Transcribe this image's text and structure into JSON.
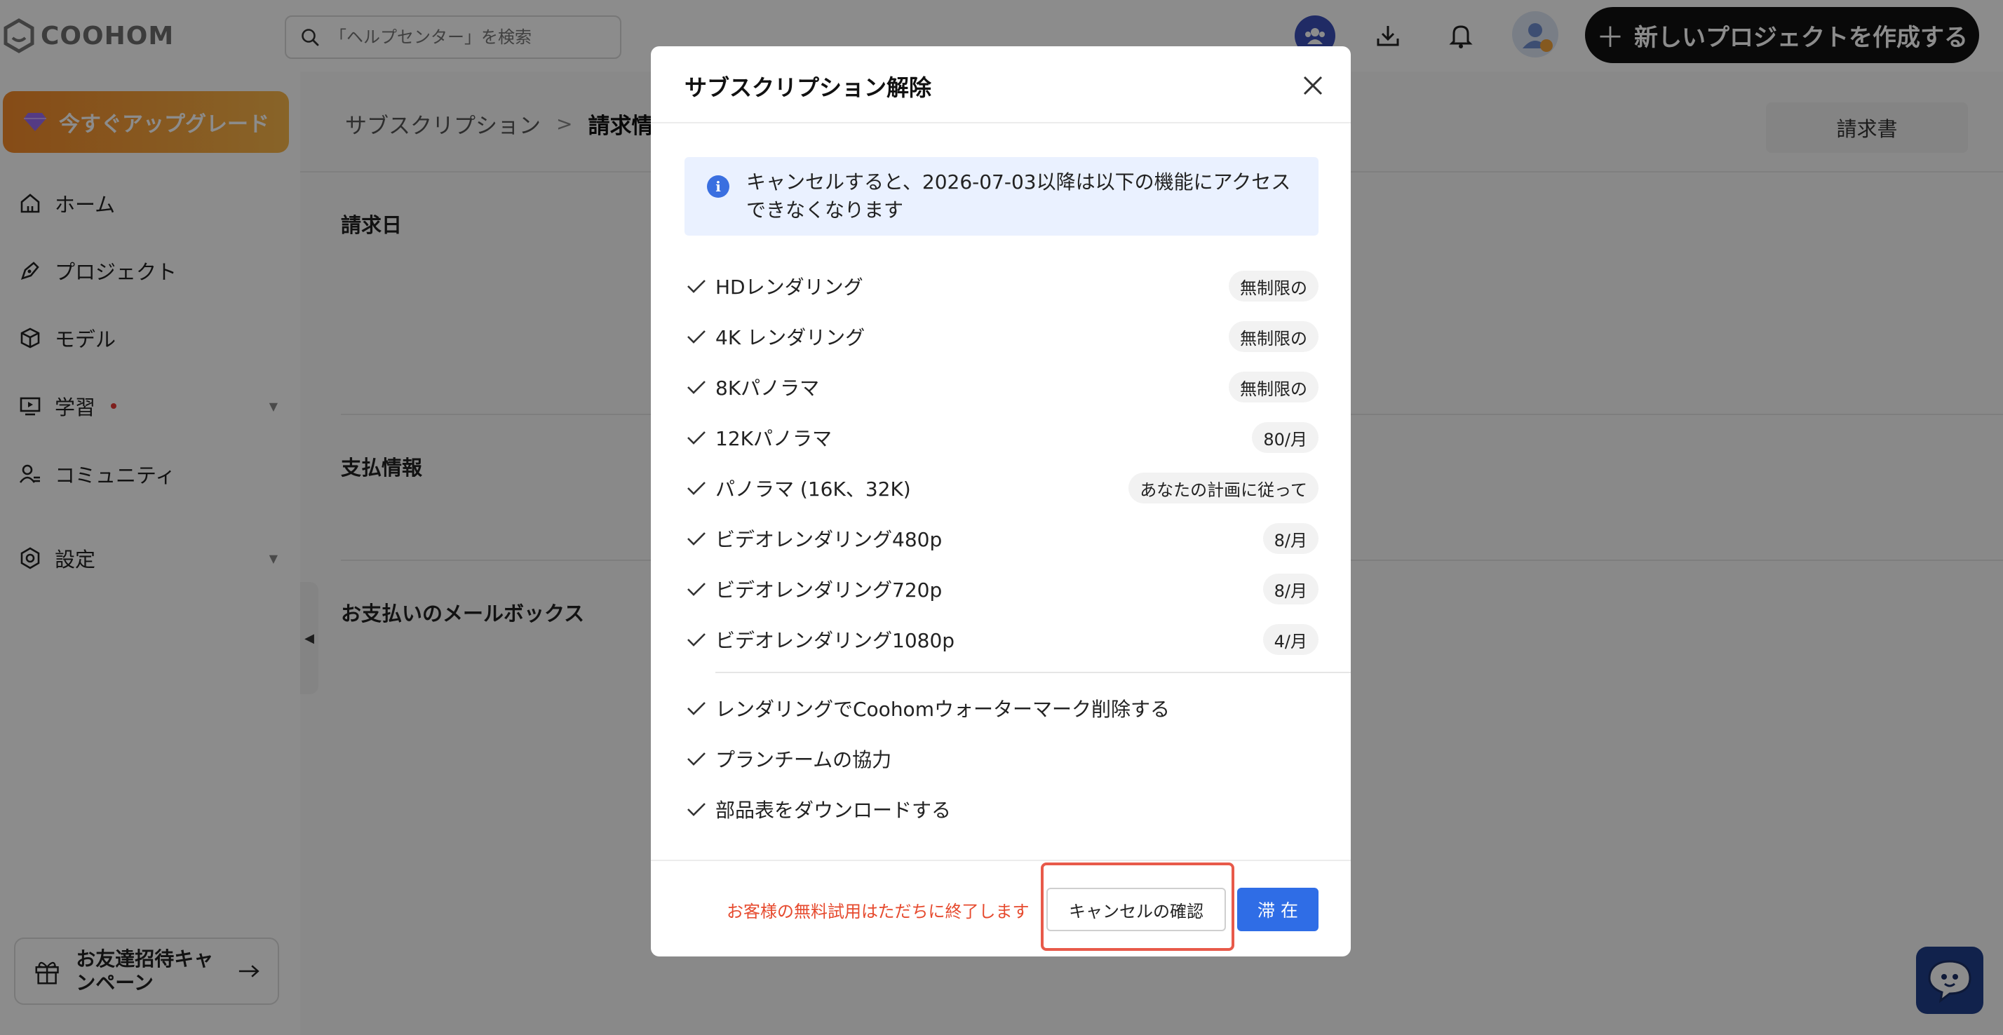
{
  "brand": {
    "name": "COOHOM"
  },
  "search": {
    "placeholder": "「ヘルプセンター」を検索"
  },
  "header": {
    "create_label": "新しいプロジェクトを作成する"
  },
  "sidebar": {
    "upgrade_label": "今すぐアップグレード",
    "items": [
      {
        "label": "ホーム",
        "icon": "home-icon"
      },
      {
        "label": "プロジェクト",
        "icon": "project-icon"
      },
      {
        "label": "モデル",
        "icon": "cube-icon"
      },
      {
        "label": "学習",
        "icon": "learning-icon"
      },
      {
        "label": "コミュニティ",
        "icon": "community-icon"
      },
      {
        "label": "設定",
        "icon": "settings-icon"
      }
    ],
    "invite_label": "お友達招待キャンペーン"
  },
  "main": {
    "breadcrumb": {
      "parent": "サブスクリプション",
      "current": "請求情報"
    },
    "invoice_label": "請求書",
    "sections": [
      "請求日",
      "支払情報",
      "お支払いのメールボックス"
    ]
  },
  "modal": {
    "title": "サブスクリプション解除",
    "info": "キャンセルすると、2026-07-03以降は以下の機能にアクセスできなくなります",
    "features": [
      {
        "label": "HDレンダリング",
        "badge": "無制限の"
      },
      {
        "label": "4K レンダリング",
        "badge": "無制限の"
      },
      {
        "label": "8Kパノラマ",
        "badge": "無制限の"
      },
      {
        "label": "12Kパノラマ",
        "badge": "80/月"
      },
      {
        "label": "パノラマ (16K、32K)",
        "badge": "あなたの計画に従って"
      },
      {
        "label": "ビデオレンダリング480p",
        "badge": "8/月"
      },
      {
        "label": "ビデオレンダリング720p",
        "badge": "8/月"
      },
      {
        "label": "ビデオレンダリング1080p",
        "badge": "4/月"
      }
    ],
    "extras": [
      "レンダリングでCoohomウォーターマーク削除する",
      "プランチームの協力",
      "部品表をダウンロードする"
    ],
    "trial_warning": "お客様の無料試用はただちに終了します",
    "confirm_label": "キャンセルの確認",
    "stay_label": "滞 在"
  },
  "colors": {
    "primary": "#2f6de6",
    "warning": "#e64a2e",
    "upgrade": "#f58a2a"
  }
}
